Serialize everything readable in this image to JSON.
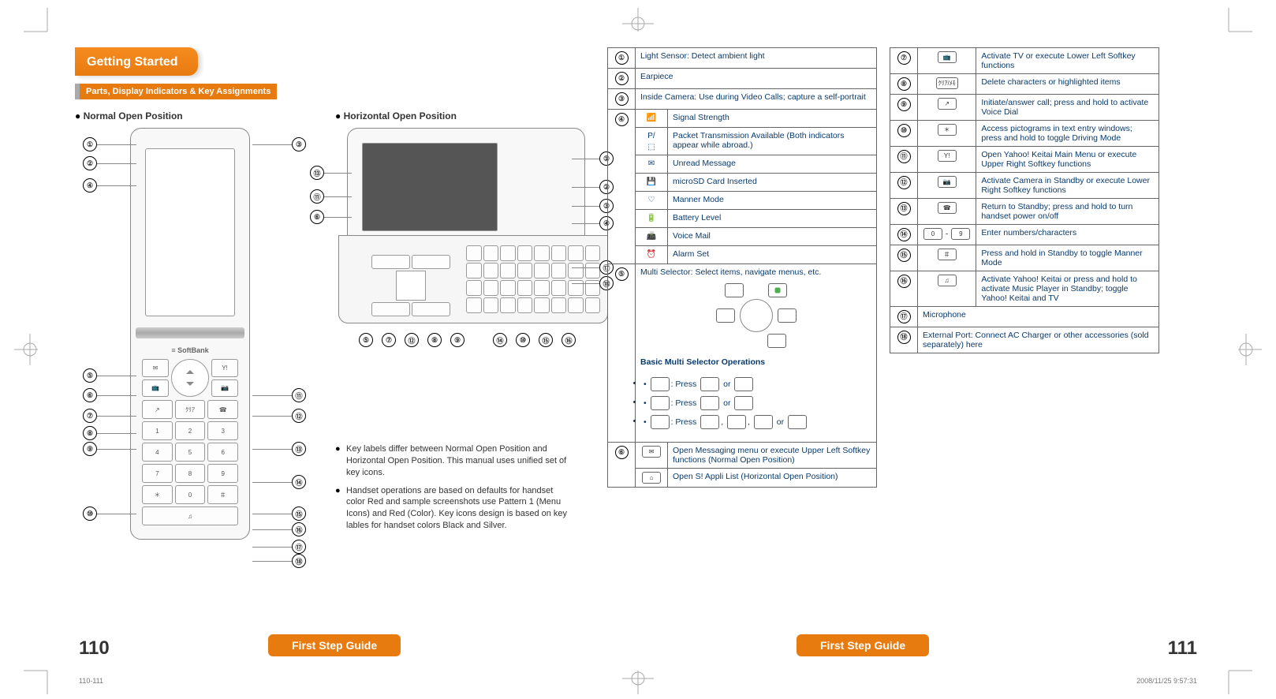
{
  "header": {
    "tab": "Getting Started",
    "section": "Parts, Display Indicators & Key Assignments"
  },
  "positions": {
    "normal": "Normal Open Position",
    "horizontal": "Horizontal Open Position",
    "brand": "SoftBank"
  },
  "callouts_normal_left": [
    "①",
    "②",
    "④",
    "⑤",
    "⑥",
    "⑦",
    "⑧",
    "⑨",
    "⑩"
  ],
  "callouts_normal_right": [
    "③",
    "⑪",
    "⑫",
    "⑬",
    "⑭",
    "⑮",
    "⑯",
    "⑰",
    "⑱"
  ],
  "callouts_horiz_right": [
    "①",
    "②",
    "③",
    "④",
    "⑰",
    "⑱"
  ],
  "callouts_horiz_left": [
    "⑬",
    "⑪",
    "⑥"
  ],
  "callouts_horiz_bottom": [
    "⑤",
    "⑦",
    "⑫",
    "⑧",
    "⑨",
    "⑭",
    "⑩",
    "⑮",
    "⑯"
  ],
  "notes": [
    "Key labels differ between Normal Open Position and Horizontal Open Position. This manual uses unified set of key icons.",
    "Handset operations are based on defaults for handset color Red and sample screenshots use Pattern 1 (Menu Icons) and Red (Color). Key icons design is based on key lables for handset colors Black and Silver."
  ],
  "tableA": {
    "r1": {
      "n": "①",
      "t": "Light Sensor: Detect ambient light"
    },
    "r2": {
      "n": "②",
      "t": "Earpiece"
    },
    "r3": {
      "n": "③",
      "t": "Inside Camera: Use during Video Calls; capture a self-portrait"
    },
    "r4": {
      "n": "④",
      "icon": "📶",
      "t": "Signal Strength"
    },
    "r4a": {
      "icon": "P/⬚",
      "t": "Packet Transmission Available (Both indicators appear while abroad.)"
    },
    "r4b": {
      "icon": "✉",
      "t": "Unread Message"
    },
    "r4c": {
      "icon": "💾",
      "t": "microSD Card Inserted"
    },
    "r4d": {
      "icon": "♡",
      "t": "Manner Mode"
    },
    "r4e": {
      "icon": "🔋",
      "t": "Battery Level"
    },
    "r4f": {
      "icon": "📠",
      "t": "Voice Mail"
    },
    "r4g": {
      "icon": "⏰",
      "t": "Alarm Set"
    },
    "r5": {
      "n": "⑤",
      "t": "Multi Selector: Select items, navigate menus, etc.",
      "ops_title": "Basic Multi Selector Operations",
      "op1_a": ": Press ",
      "op1_b": " or ",
      "op2_a": ": Press ",
      "op2_b": " or ",
      "op3_a": ": Press ",
      "op3_b": ", ",
      "op3_c": ", ",
      "op3_d": " or "
    },
    "r6": {
      "n": "⑥",
      "icon": "✉",
      "t": "Open Messaging menu or execute Upper Left Softkey functions (Normal Open Position)"
    },
    "r6b": {
      "icon": "⌂",
      "t": "Open S! Appli List (Horizontal Open Position)"
    }
  },
  "tableB": {
    "r7": {
      "n": "⑦",
      "key": "📺",
      "t": "Activate TV or execute Lower Left Softkey functions"
    },
    "r8": {
      "n": "⑧",
      "key": "ｸﾘｱ/ﾒﾓ",
      "t": "Delete characters or highlighted items"
    },
    "r9": {
      "n": "⑨",
      "key": "↗",
      "t": "Initiate/answer call; press and hold to activate Voice Dial"
    },
    "r10": {
      "n": "⑩",
      "key": "＊",
      "t": "Access pictograms in text entry windows; press and hold to toggle Driving Mode"
    },
    "r11": {
      "n": "⑪",
      "key": "Y!",
      "t": "Open Yahoo! Keitai Main Menu or execute Upper Right Softkey functions"
    },
    "r12": {
      "n": "⑫",
      "key": "📷",
      "t": "Activate Camera in Standby or execute Lower Right Softkey functions"
    },
    "r13": {
      "n": "⑬",
      "key": "☎",
      "t": "Return to Standby; press and hold to turn handset power on/off"
    },
    "r14": {
      "n": "⑭",
      "key1": "0",
      "dash": " - ",
      "key2": "9",
      "t": "Enter numbers/characters"
    },
    "r15": {
      "n": "⑮",
      "key": "＃",
      "t": "Press and hold in Standby to toggle Manner Mode"
    },
    "r16": {
      "n": "⑯",
      "key": "♫",
      "t": "Activate Yahoo! Keitai or press and hold to activate Music Player in Standby; toggle Yahoo! Keitai and TV"
    },
    "r17": {
      "n": "⑰",
      "t": "Microphone"
    },
    "r18": {
      "n": "⑱",
      "t": "External Port: Connect AC Charger or other accessories (sold separately) here"
    }
  },
  "footer": {
    "guide": "First Step Guide",
    "left_num": "110",
    "right_num": "111",
    "sheet": "110-111",
    "timestamp": "2008/11/25   9:57:31"
  }
}
